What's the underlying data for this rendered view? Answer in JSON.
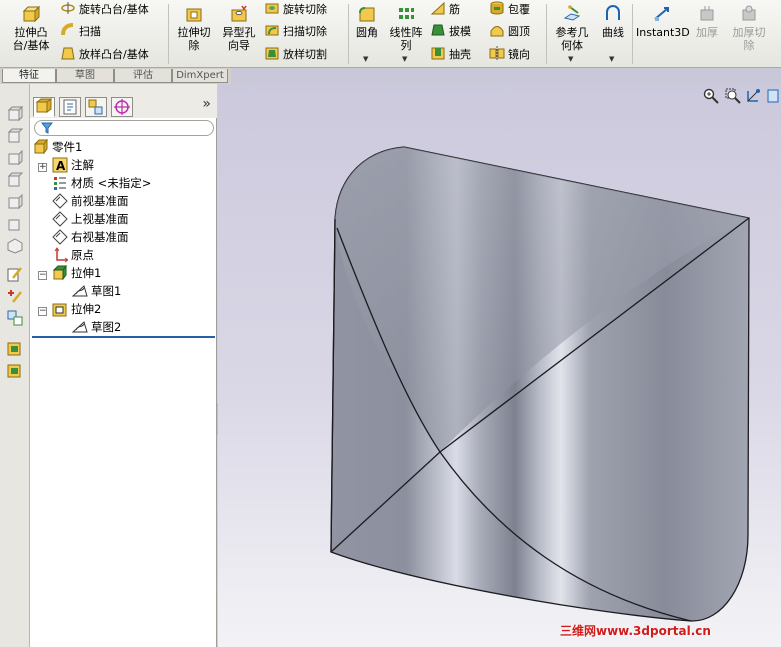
{
  "toolbar": {
    "extrude_boss": "拉伸凸\n台/基体",
    "revolve_boss": "旋转凸台/基体",
    "sweep": "扫描",
    "loft_boss": "放样凸台/基体",
    "extrude_cut": "拉伸切\n除",
    "hole_wizard": "异型孔\n向导",
    "revolve_cut": "旋转切除",
    "sweep_cut": "扫描切除",
    "loft_cut": "放样切割",
    "fillet": "圆角",
    "linear_pattern": "线性阵\n列",
    "rib": "筋",
    "draft": "拔模",
    "shell": "抽壳",
    "wrap": "包覆",
    "dome": "圆顶",
    "mirror": "镜向",
    "reference_geometry": "参考几\n何体",
    "curves": "曲线",
    "instant3d": "Instant3D",
    "thicken": "加厚",
    "thicken_cut": "加厚切\n除"
  },
  "cm_tabs": [
    "特征",
    "草图",
    "评估",
    "DimXpert"
  ],
  "feature_tree": {
    "part": "零件1",
    "annotations": "注解",
    "material": "材质 <未指定>",
    "front_plane": "前视基准面",
    "top_plane": "上视基准面",
    "right_plane": "右视基准面",
    "origin": "原点",
    "extrude1": "拉伸1",
    "sketch1": "草图1",
    "extrude2": "拉伸2",
    "sketch2": "草图2"
  },
  "watermark": "三维网www.3dportal.cn",
  "colors": {
    "toolbar_bg": "#ecebe5",
    "viewport_top": "#ccc9dd",
    "viewport_bottom": "#f3f3f6",
    "model_face": "#8d919f",
    "selection_bar": "#2b5ea8",
    "watermark": "#d21b1b"
  }
}
